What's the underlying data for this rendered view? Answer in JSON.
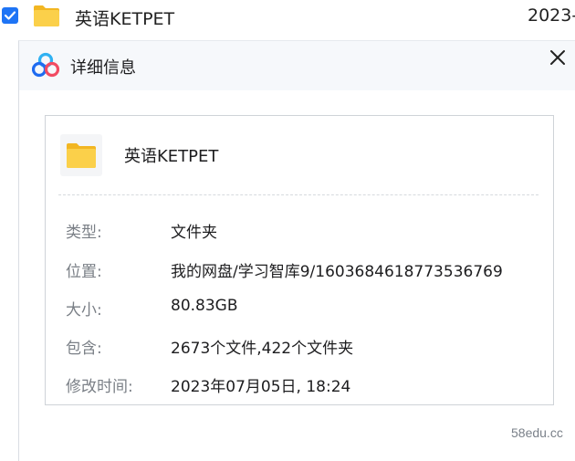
{
  "file_list": {
    "row": {
      "name": "英语KETPET",
      "date": "2023-"
    }
  },
  "dialog": {
    "title": "详细信息",
    "icons": {
      "app": "baidu-netdisk-cloud-icon",
      "close": "close-icon",
      "folder": "folder-icon"
    },
    "file_name": "英语KETPET",
    "details": [
      {
        "label": "类型:",
        "value": "文件夹"
      },
      {
        "label": "位置:",
        "value": "我的网盘/学习智库9/1603684618773536769"
      },
      {
        "label": "大小:",
        "value": "80.83GB"
      },
      {
        "label": "包含:",
        "value": "2673个文件,422个文件夹"
      },
      {
        "label": "修改时间:",
        "value": "2023年07月05日, 18:24"
      }
    ]
  },
  "watermark": "58edu.cc",
  "colors": {
    "accent": "#1e74f5",
    "folder": "#f9c931",
    "label": "#7a7f86"
  }
}
